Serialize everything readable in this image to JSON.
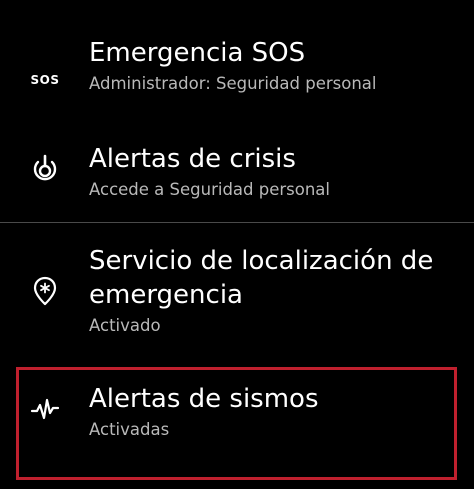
{
  "items": [
    {
      "title": "Emergencia SOS",
      "subtitle": "Administrador: Seguridad personal",
      "icon_text": "SOS",
      "icon": "sos-icon"
    },
    {
      "title": "Alertas de crisis",
      "subtitle": "Accede a Seguridad personal",
      "icon": "crisis-alert-icon"
    },
    {
      "title": "Servicio de localización de emergencia",
      "subtitle": "Activado",
      "icon": "location-pin-asterisk-icon"
    },
    {
      "title": "Alertas de sismos",
      "subtitle": "Activadas",
      "icon": "earthquake-wave-icon"
    }
  ],
  "colors": {
    "background": "#000000",
    "title": "#ffffff",
    "subtitle": "#b9b9b9",
    "divider": "#4a4a4a",
    "highlight": "#c0202e"
  }
}
